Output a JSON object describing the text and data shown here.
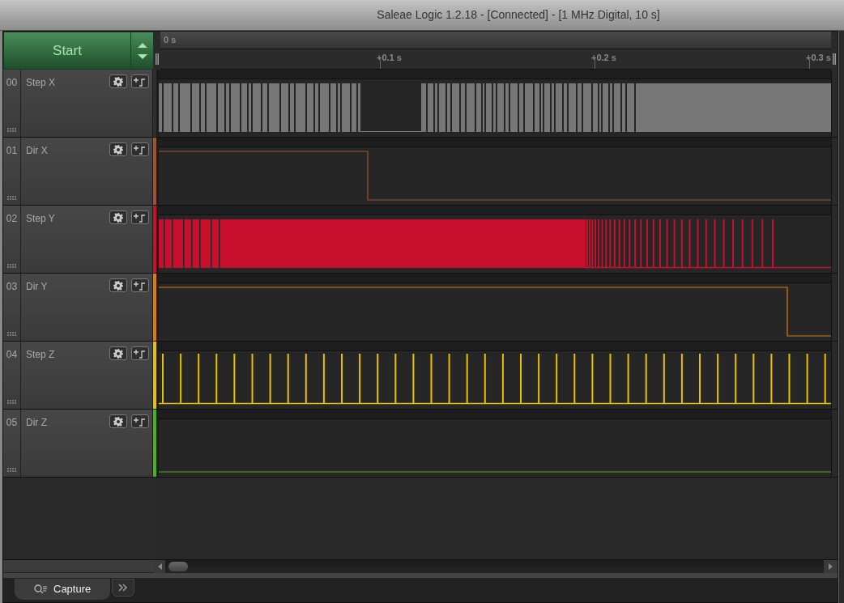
{
  "window": {
    "title": "Saleae Logic 1.2.18 - [Connected] - [1 MHz Digital, 10 s]"
  },
  "start_button": {
    "label": "Start"
  },
  "timeline": {
    "origin": "0 s",
    "ticks": [
      "+0.1 s",
      "+0.2 s",
      "+0.3 s"
    ]
  },
  "channels": [
    {
      "number": "00",
      "name": "Step X",
      "color": "#2e2e2e",
      "kind": "burst"
    },
    {
      "number": "01",
      "name": "Dir X",
      "color": "#a0522d",
      "kind": "fall"
    },
    {
      "number": "02",
      "name": "Step Y",
      "color": "#c8102e",
      "kind": "fill"
    },
    {
      "number": "03",
      "name": "Dir Y",
      "color": "#e07b00",
      "kind": "fall"
    },
    {
      "number": "04",
      "name": "Step Z",
      "color": "#e8c000",
      "kind": "train"
    },
    {
      "number": "05",
      "name": "Dir Z",
      "color": "#4caf20",
      "kind": "flat"
    }
  ],
  "tabs": [
    {
      "label": "Capture",
      "selected": true
    }
  ]
}
